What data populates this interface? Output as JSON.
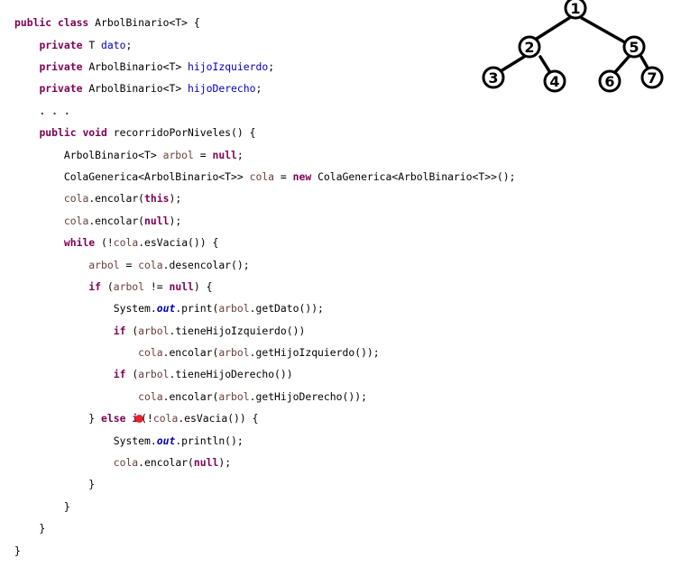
{
  "code": {
    "l1": [
      {
        "t": "public class ",
        "c": "kw"
      },
      {
        "t": "ArbolBinario<T> {",
        "c": ""
      }
    ],
    "l2": [
      {
        "t": "    ",
        "c": ""
      },
      {
        "t": "private ",
        "c": "kw"
      },
      {
        "t": "T ",
        "c": ""
      },
      {
        "t": "dato",
        "c": "fld"
      },
      {
        "t": ";",
        "c": ""
      }
    ],
    "l3": [
      {
        "t": "    ",
        "c": ""
      },
      {
        "t": "private ",
        "c": "kw"
      },
      {
        "t": "ArbolBinario<T> ",
        "c": ""
      },
      {
        "t": "hijoIzquierdo",
        "c": "fld"
      },
      {
        "t": ";",
        "c": ""
      }
    ],
    "l4": [
      {
        "t": "    ",
        "c": ""
      },
      {
        "t": "private ",
        "c": "kw"
      },
      {
        "t": "ArbolBinario<T> ",
        "c": ""
      },
      {
        "t": "hijoDerecho",
        "c": "fld"
      },
      {
        "t": ";",
        "c": ""
      }
    ],
    "l5": [
      {
        "t": "    . . .",
        "c": "kw"
      }
    ],
    "l6": [
      {
        "t": "    ",
        "c": ""
      },
      {
        "t": "public void ",
        "c": "kw"
      },
      {
        "t": "recorridoPorNiveles() {",
        "c": ""
      }
    ],
    "l7": [
      {
        "t": "        ArbolBinario<T> ",
        "c": ""
      },
      {
        "t": "arbol",
        "c": "var"
      },
      {
        "t": " = ",
        "c": ""
      },
      {
        "t": "null",
        "c": "kw"
      },
      {
        "t": ";",
        "c": ""
      }
    ],
    "l8": [
      {
        "t": "        ColaGenerica<ArbolBinario<T>> ",
        "c": ""
      },
      {
        "t": "cola",
        "c": "var"
      },
      {
        "t": " = ",
        "c": ""
      },
      {
        "t": "new ",
        "c": "kw"
      },
      {
        "t": "ColaGenerica<ArbolBinario<T>>();",
        "c": ""
      }
    ],
    "l9": [
      {
        "t": "        ",
        "c": ""
      },
      {
        "t": "cola",
        "c": "var"
      },
      {
        "t": ".encolar(",
        "c": ""
      },
      {
        "t": "this",
        "c": "kw"
      },
      {
        "t": ");",
        "c": ""
      }
    ],
    "l10": [
      {
        "t": "        ",
        "c": ""
      },
      {
        "t": "cola",
        "c": "var"
      },
      {
        "t": ".encolar(",
        "c": ""
      },
      {
        "t": "null",
        "c": "kw"
      },
      {
        "t": ");",
        "c": ""
      }
    ],
    "l11": [
      {
        "t": "        ",
        "c": ""
      },
      {
        "t": "while ",
        "c": "kw"
      },
      {
        "t": "(!",
        "c": ""
      },
      {
        "t": "cola",
        "c": "var"
      },
      {
        "t": ".esVacia()) {",
        "c": ""
      }
    ],
    "l12": [
      {
        "t": "            ",
        "c": ""
      },
      {
        "t": "arbol",
        "c": "var"
      },
      {
        "t": " = ",
        "c": ""
      },
      {
        "t": "cola",
        "c": "var"
      },
      {
        "t": ".desencolar();",
        "c": ""
      }
    ],
    "l13": [
      {
        "t": "            ",
        "c": ""
      },
      {
        "t": "if ",
        "c": "kw"
      },
      {
        "t": "(",
        "c": ""
      },
      {
        "t": "arbol",
        "c": "var"
      },
      {
        "t": " != ",
        "c": ""
      },
      {
        "t": "null",
        "c": "kw"
      },
      {
        "t": ") {",
        "c": ""
      }
    ],
    "l14": [
      {
        "t": "                System.",
        "c": ""
      },
      {
        "t": "out",
        "c": "st"
      },
      {
        "t": ".print(",
        "c": ""
      },
      {
        "t": "arbol",
        "c": "var"
      },
      {
        "t": ".getDato());",
        "c": ""
      }
    ],
    "l15": [
      {
        "t": "                ",
        "c": ""
      },
      {
        "t": "if ",
        "c": "kw"
      },
      {
        "t": "(",
        "c": ""
      },
      {
        "t": "arbol",
        "c": "var"
      },
      {
        "t": ".tieneHijoIzquierdo())",
        "c": ""
      }
    ],
    "l16": [
      {
        "t": "                    ",
        "c": ""
      },
      {
        "t": "cola",
        "c": "var"
      },
      {
        "t": ".encolar(",
        "c": ""
      },
      {
        "t": "arbol",
        "c": "var"
      },
      {
        "t": ".getHijoIzquierdo());",
        "c": ""
      }
    ],
    "l17": [
      {
        "t": "                ",
        "c": ""
      },
      {
        "t": "if ",
        "c": "kw"
      },
      {
        "t": "(",
        "c": ""
      },
      {
        "t": "arbol",
        "c": "var"
      },
      {
        "t": ".tieneHijoDerecho())",
        "c": ""
      }
    ],
    "l18": [
      {
        "t": "                    ",
        "c": ""
      },
      {
        "t": "cola",
        "c": "var"
      },
      {
        "t": ".encolar(",
        "c": ""
      },
      {
        "t": "arbol",
        "c": "var"
      },
      {
        "t": ".getHijoDerecho());",
        "c": ""
      }
    ],
    "l19a": [
      {
        "t": "            } ",
        "c": ""
      },
      {
        "t": "else i",
        "c": "kw"
      }
    ],
    "l19b": [
      {
        "t": "(!",
        "c": ""
      },
      {
        "t": "cola",
        "c": "var"
      },
      {
        "t": ".esVacia()) {",
        "c": ""
      }
    ],
    "l20": [
      {
        "t": "                System.",
        "c": ""
      },
      {
        "t": "out",
        "c": "st"
      },
      {
        "t": ".println();",
        "c": ""
      }
    ],
    "l21": [
      {
        "t": "                ",
        "c": ""
      },
      {
        "t": "cola",
        "c": "var"
      },
      {
        "t": ".encolar(",
        "c": ""
      },
      {
        "t": "null",
        "c": "kw"
      },
      {
        "t": ");",
        "c": ""
      }
    ],
    "l22": [
      {
        "t": "            }",
        "c": ""
      }
    ],
    "l23": [
      {
        "t": "        }",
        "c": ""
      }
    ],
    "l24": [
      {
        "t": "    }",
        "c": ""
      }
    ],
    "l25": [
      {
        "t": "}",
        "c": ""
      }
    ]
  },
  "colors": {
    "keyword": "#7f0055",
    "field": "#0000c0",
    "local_variable": "#6a3e3e",
    "breakpoint": "#e8222a"
  },
  "tree": {
    "root": "1",
    "left": "2",
    "right": "5",
    "left_left": "3",
    "left_right": "4",
    "right_left": "6",
    "right_right": "7"
  }
}
